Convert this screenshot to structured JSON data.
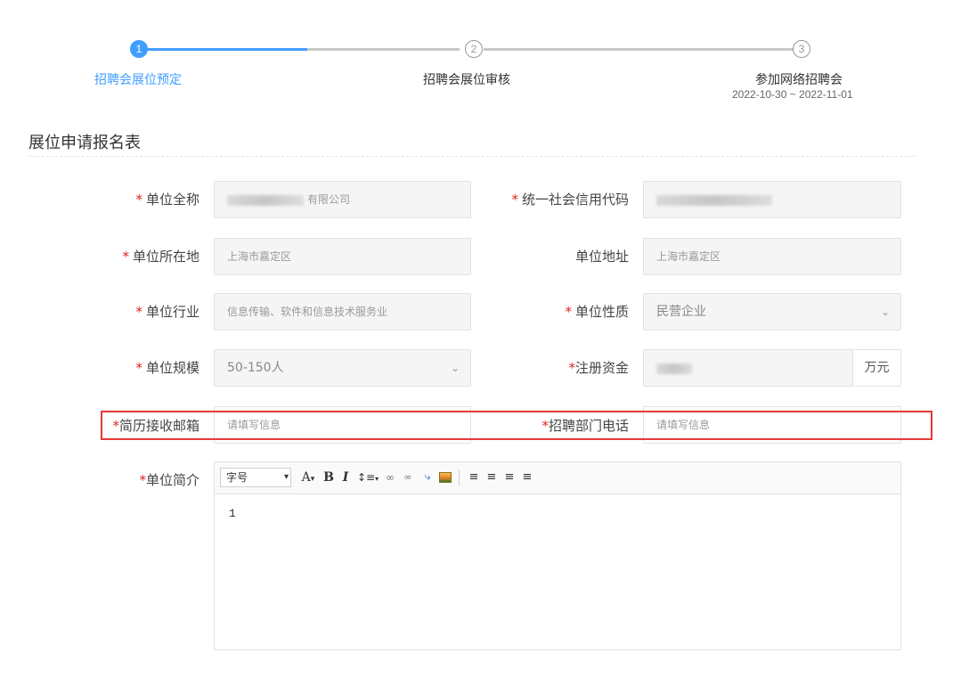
{
  "steps": [
    {
      "num": "1",
      "title": "招聘会展位预定",
      "date": ""
    },
    {
      "num": "2",
      "title": "招聘会展位审核",
      "date": ""
    },
    {
      "num": "3",
      "title": "参加网络招聘会",
      "date": "2022-10-30 ~ 2022-11-01"
    }
  ],
  "colors": {
    "accent": "#409eff",
    "required": "#e02020",
    "highlight": "#e53935"
  },
  "section": {
    "title": "展位申请报名表"
  },
  "form": {
    "required_mark": "*",
    "company_name": {
      "label": "单位全称",
      "value_suffix": "有限公司"
    },
    "credit_code": {
      "label": "统一社会信用代码"
    },
    "location": {
      "label": "单位所在地",
      "value": "上海市嘉定区"
    },
    "address": {
      "label": "单位地址",
      "value": "上海市嘉定区"
    },
    "industry": {
      "label": "单位行业",
      "value": "信息传输、软件和信息技术服务业"
    },
    "nature": {
      "label": "单位性质",
      "value": "民营企业"
    },
    "scale": {
      "label": "单位规模",
      "value": "50-150人"
    },
    "capital": {
      "label": "注册资金",
      "unit": "万元"
    },
    "resume_email": {
      "label": "简历接收邮箱",
      "placeholder": "请填写信息"
    },
    "hr_phone": {
      "label": "招聘部门电话",
      "placeholder": "请填写信息"
    },
    "intro": {
      "label": "单位简介",
      "content": "1"
    }
  },
  "editor": {
    "font_size_label": "字号",
    "toolbar_icons": [
      "font-color-icon",
      "bold-icon",
      "italic-icon",
      "line-height-icon",
      "link-icon",
      "unlink-icon",
      "attachment-icon",
      "image-icon",
      "align-left-icon",
      "align-center-icon",
      "align-right-icon",
      "align-justify-icon"
    ]
  }
}
